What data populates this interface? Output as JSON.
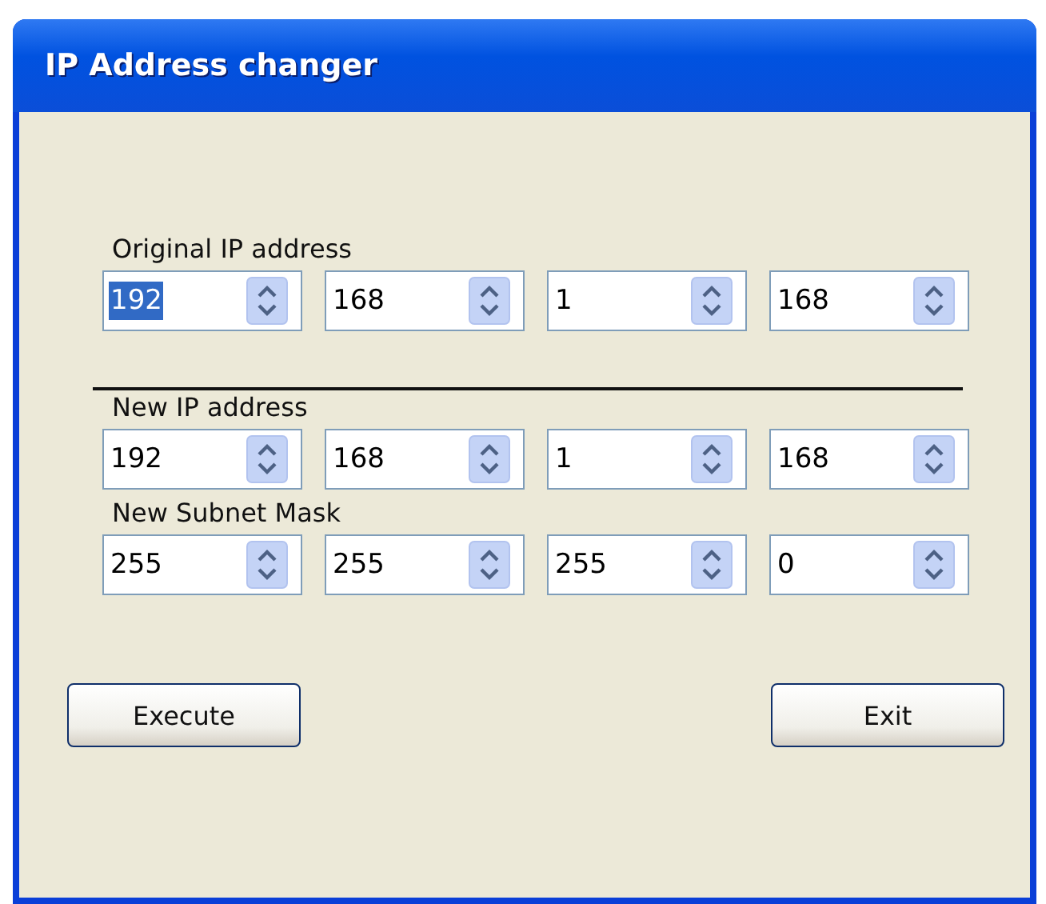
{
  "window": {
    "title": "IP Address changer"
  },
  "groups": [
    {
      "label": "Original IP address",
      "fields": [
        {
          "value": "192",
          "selected": true
        },
        {
          "value": "168",
          "selected": false
        },
        {
          "value": "1",
          "selected": false
        },
        {
          "value": "168",
          "selected": false
        }
      ]
    },
    {
      "label": "New IP address",
      "fields": [
        {
          "value": "192",
          "selected": false
        },
        {
          "value": "168",
          "selected": false
        },
        {
          "value": "1",
          "selected": false
        },
        {
          "value": "168",
          "selected": false
        }
      ]
    },
    {
      "label": "New Subnet Mask",
      "fields": [
        {
          "value": "255",
          "selected": false
        },
        {
          "value": "255",
          "selected": false
        },
        {
          "value": "255",
          "selected": false
        },
        {
          "value": "0",
          "selected": false
        }
      ]
    }
  ],
  "buttons": [
    "Execute",
    "Exit"
  ]
}
